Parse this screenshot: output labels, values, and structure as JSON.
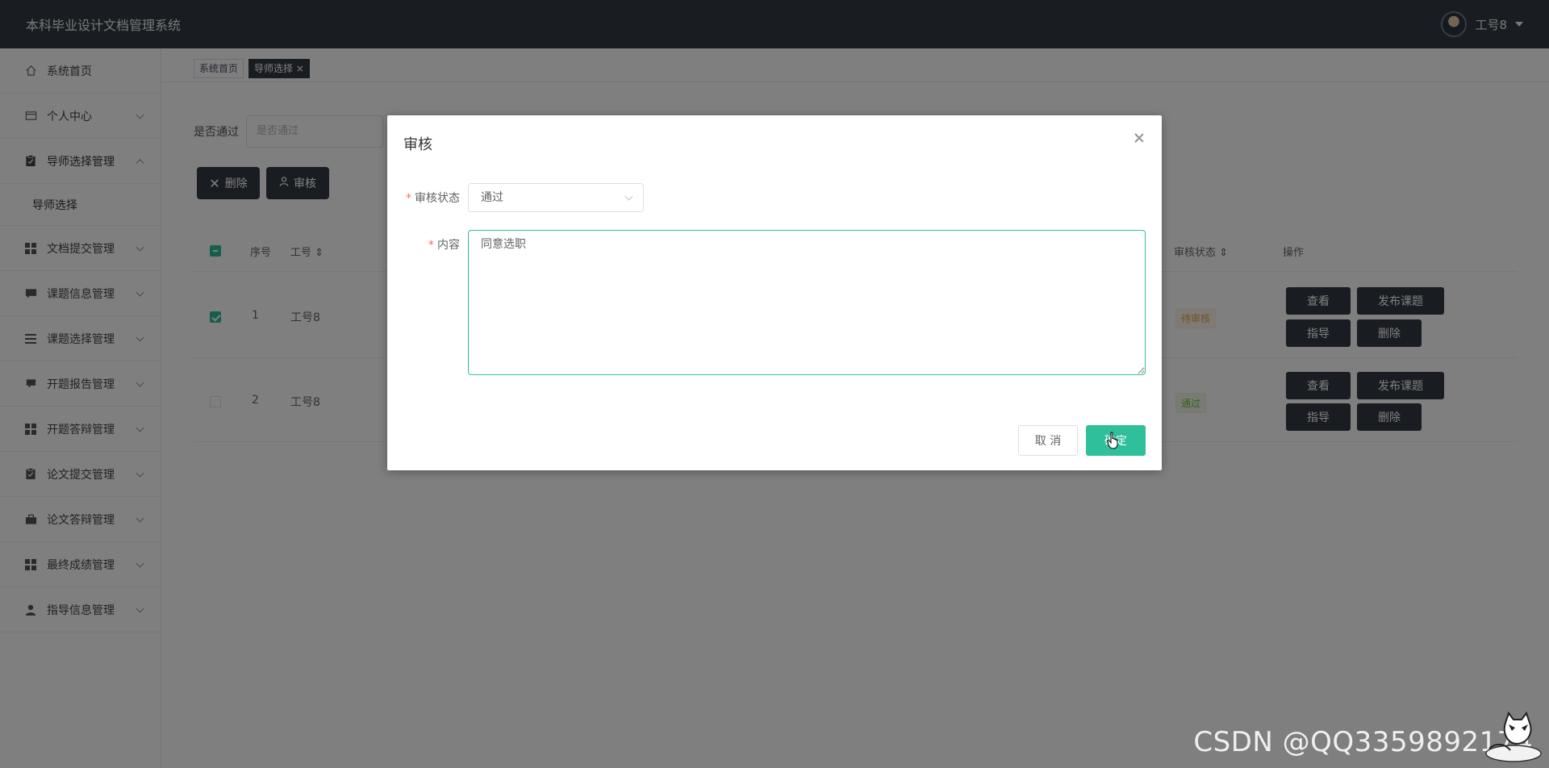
{
  "header": {
    "app_title": "本科毕业设计文档管理系统",
    "user_name": "工号8"
  },
  "sidebar": {
    "items": [
      {
        "label": "系统首页",
        "icon": "home-icon"
      },
      {
        "label": "个人中心",
        "icon": "id-card-icon"
      },
      {
        "label": "导师选择管理",
        "icon": "clipboard-icon",
        "expanded": true,
        "children": [
          {
            "label": "导师选择"
          }
        ]
      },
      {
        "label": "文档提交管理",
        "icon": "grid-icon"
      },
      {
        "label": "课题信息管理",
        "icon": "message-icon"
      },
      {
        "label": "课题选择管理",
        "icon": "list-icon"
      },
      {
        "label": "开题报告管理",
        "icon": "chat-icon"
      },
      {
        "label": "开题答辩管理",
        "icon": "grid-icon"
      },
      {
        "label": "论文提交管理",
        "icon": "clipboard-icon"
      },
      {
        "label": "论文答辩管理",
        "icon": "briefcase-icon"
      },
      {
        "label": "最终成绩管理",
        "icon": "grid-icon"
      },
      {
        "label": "指导信息管理",
        "icon": "user-icon"
      }
    ]
  },
  "tags": {
    "home": "系统首页",
    "current": "导师选择"
  },
  "filter": {
    "label": "是否通过",
    "placeholder": "是否通过"
  },
  "toolbar": {
    "delete_label": "删除",
    "review_label": "审核"
  },
  "table": {
    "headers": {
      "index": "序号",
      "job_no": "工号",
      "review_status": "审核状态",
      "actions": "操作"
    },
    "rows": [
      {
        "index": "1",
        "job_no": "工号8",
        "status": "待审核",
        "checked": true
      },
      {
        "index": "2",
        "job_no": "工号8",
        "status": "通过",
        "checked": false
      }
    ],
    "actions": {
      "view": "查看",
      "publish": "发布课题",
      "guide": "指导",
      "delete": "删除"
    }
  },
  "dialog": {
    "title": "审核",
    "status_label": "审核状态",
    "status_value": "通过",
    "content_label": "内容",
    "content_value": "同意选职",
    "cancel_label": "取 消",
    "ok_label": "确定"
  },
  "watermark": "CSDN @QQ3359892174",
  "colors": {
    "header_bg": "#323a45",
    "accent": "#2fbf9b",
    "required": "#f56c6c"
  }
}
